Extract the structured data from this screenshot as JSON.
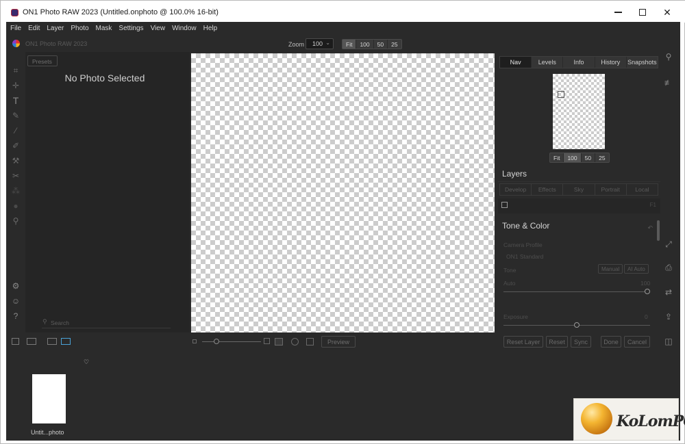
{
  "window": {
    "title": "ON1 Photo RAW 2023 (Untitled.onphoto @ 100.0% 16-bit)"
  },
  "menu": [
    "File",
    "Edit",
    "Layer",
    "Photo",
    "Mask",
    "Settings",
    "View",
    "Window",
    "Help"
  ],
  "toolbar": {
    "brand": "ON1 Photo RAW 2023",
    "zoom_label": "Zoom",
    "zoom_value": "100",
    "zoom_presets": [
      "Fit",
      "100",
      "50",
      "25"
    ]
  },
  "left_panel": {
    "presets_tab": "Presets",
    "empty_message": "No Photo Selected",
    "search_placeholder": "Search"
  },
  "canvas_controls": {
    "preview_label": "Preview"
  },
  "filmstrip": {
    "thumb_label": "Untit...photo"
  },
  "right_panel": {
    "tabs": [
      "Nav",
      "Levels",
      "Info",
      "History",
      "Snapshots"
    ],
    "active_tab": "Nav",
    "nav_zoom": [
      "Fit",
      "100",
      "50",
      "25"
    ],
    "layers_title": "Layers",
    "layer_tabs": [
      "Develop",
      "Effects",
      "Sky",
      "Portrait",
      "Local"
    ],
    "layer_shortcut": "F1",
    "tone_color_title": "Tone & Color",
    "camera_profile_label": "Camera Profile",
    "camera_profile_value": "ON1 Standard",
    "tone_label": "Tone",
    "tone_buttons": [
      "Manual",
      "AI Auto"
    ],
    "auto_label": "Auto",
    "auto_value": "100",
    "exposure_label": "Exposure",
    "exposure_value": "0",
    "bottom_buttons": [
      "Reset Layer",
      "Reset",
      "Sync",
      "Done",
      "Cancel"
    ]
  },
  "watermark": {
    "text": "KoLomPC"
  }
}
